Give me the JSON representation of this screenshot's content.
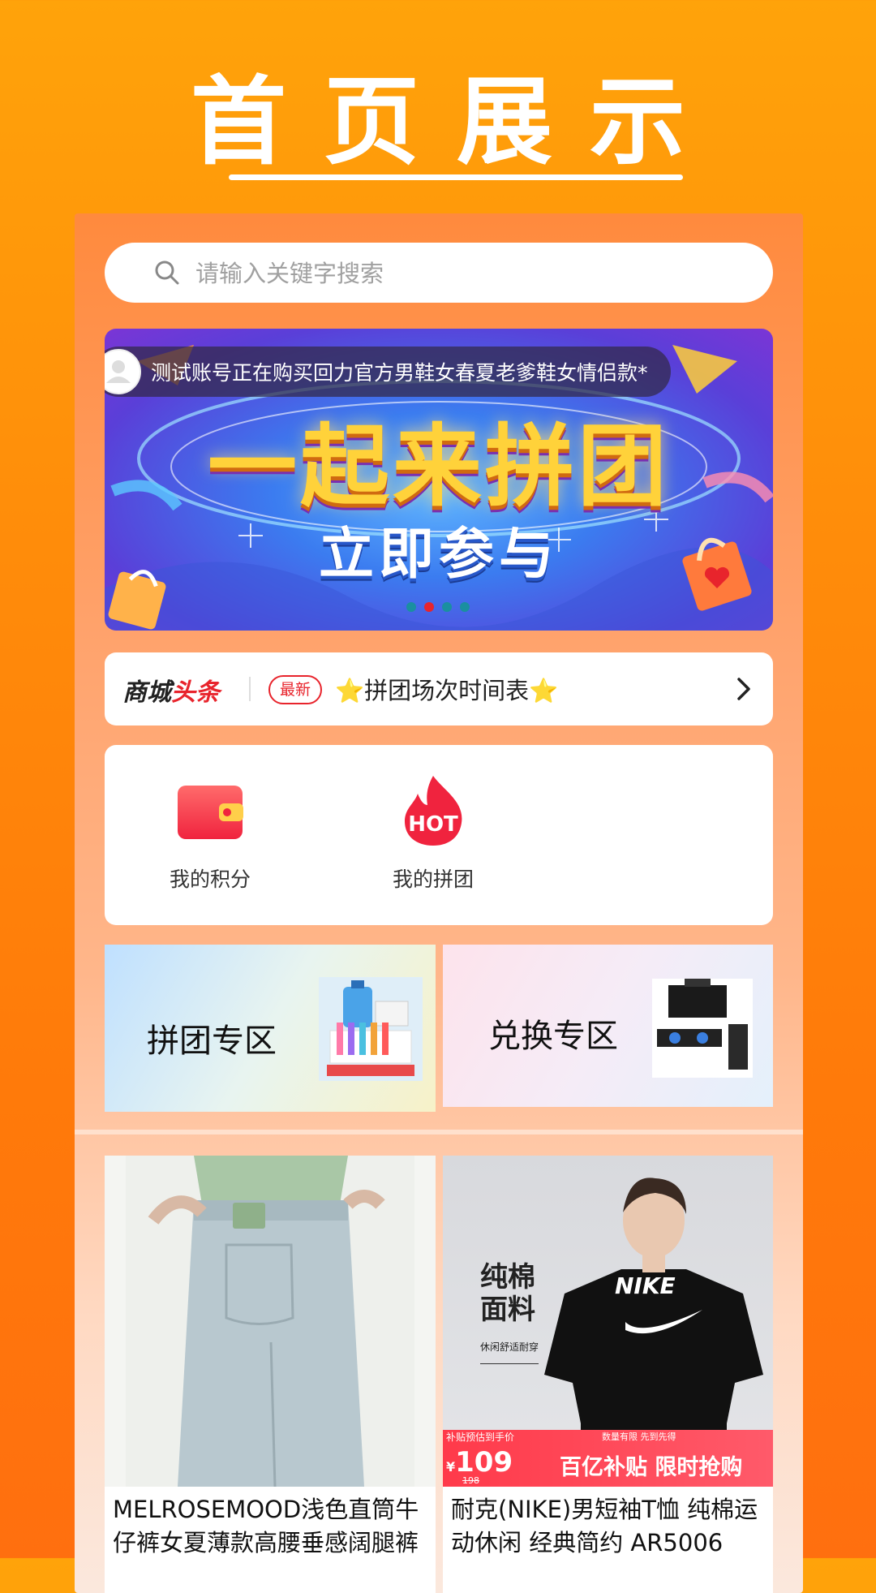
{
  "page": {
    "title": "首页展示"
  },
  "search": {
    "placeholder": "请输入关键字搜索"
  },
  "banner": {
    "headline": "一起来拼团",
    "subline": "立即参与",
    "ticker_text": "测试账号正在购买回力官方男鞋女春夏老爹鞋女情侣款*",
    "dots": 4,
    "active_dot": 1
  },
  "news": {
    "brand_black": "商城",
    "brand_red": "头条",
    "badge": "最新",
    "headline": "⭐拼团场次时间表⭐"
  },
  "features": [
    {
      "label": "我的积分",
      "icon": "wallet-icon"
    },
    {
      "label": "我的拼团",
      "icon": "hot-flame-icon"
    }
  ],
  "zones": {
    "group_buy": "拼团专区",
    "exchange": "兑换专区"
  },
  "products": [
    {
      "title": "MELROSEMOOD浅色直筒牛仔裤女夏薄款高腰垂感阔腿裤",
      "image": "jeans-photo"
    },
    {
      "title": "耐克(NIKE)男短袖T恤 纯棉运动休闲 经典简约 AR5006",
      "image": "nike-tshirt-photo",
      "overlay": {
        "side_text_1": "纯棉",
        "side_text_2": "面料",
        "side_caption": "休闲舒适耐穿",
        "subsidy_label": "补贴预估到手价",
        "price_symbol": "¥",
        "price": "109",
        "original_price": "198",
        "promo_small": "数量有限 先到先得",
        "promo": "百亿补贴 限时抢购",
        "logo": "NIKE"
      }
    }
  ],
  "colors": {
    "accent_orange": "#ff8c0a",
    "brand_red": "#e8242c"
  }
}
